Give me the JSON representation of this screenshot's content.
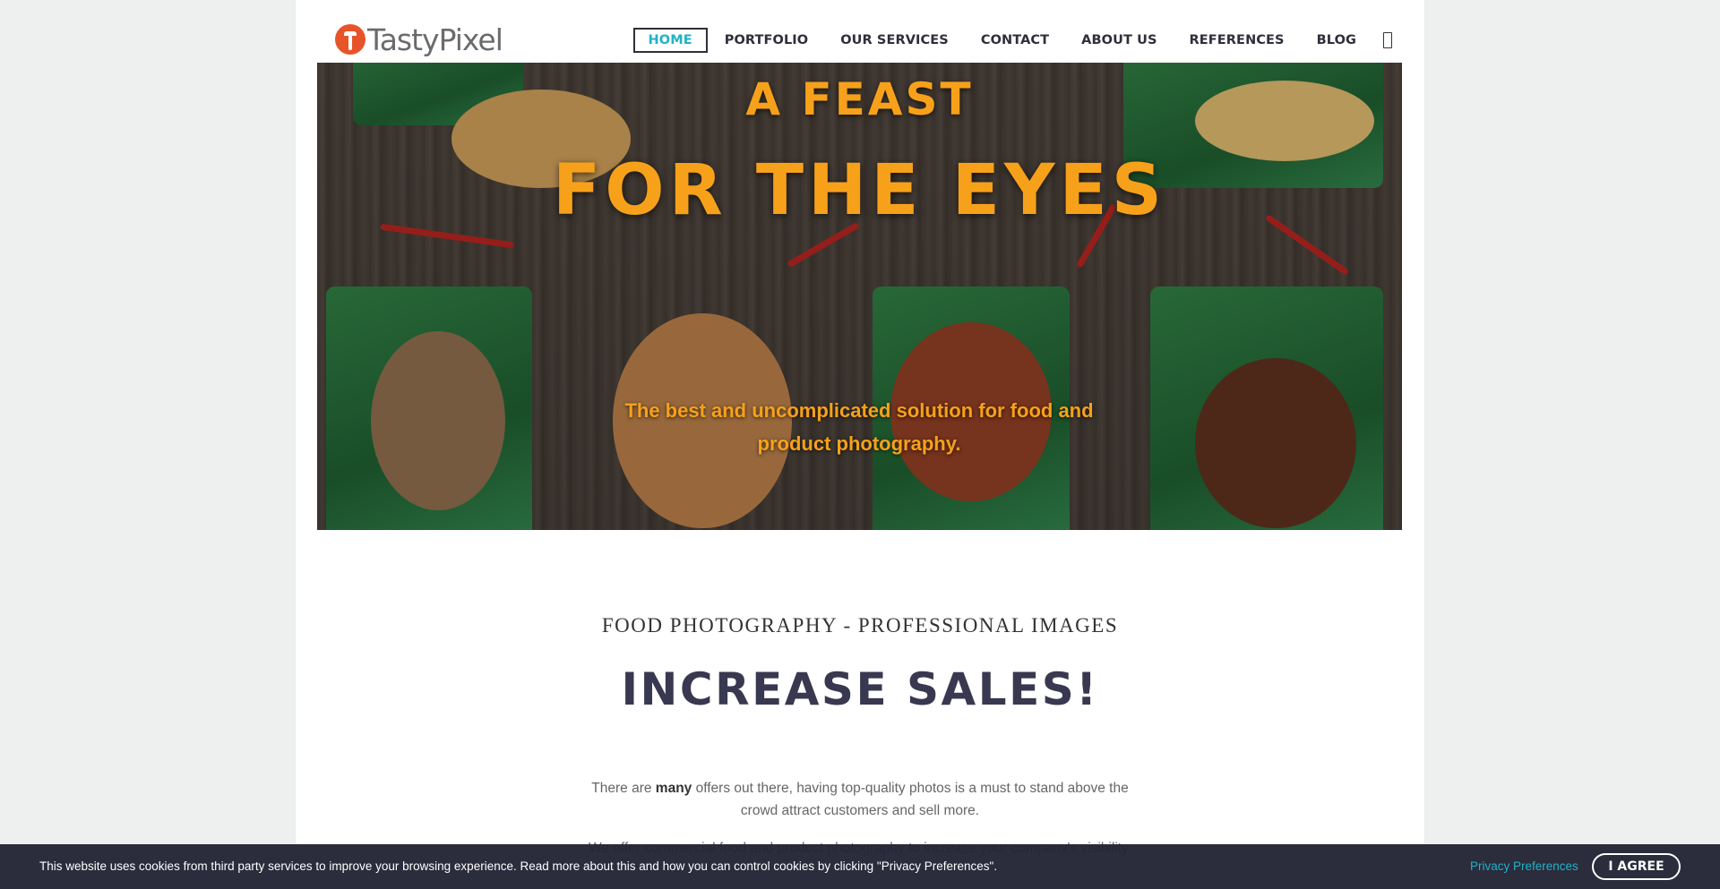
{
  "brand": {
    "name": "TastyPixel"
  },
  "nav": {
    "items": [
      {
        "label": "HOME",
        "active": true
      },
      {
        "label": "PORTFOLIO"
      },
      {
        "label": "OUR SERVICES"
      },
      {
        "label": "CONTACT"
      },
      {
        "label": "ABOUT US"
      },
      {
        "label": "REFERENCES"
      },
      {
        "label": "BLOG"
      }
    ],
    "search_icon": "search-icon"
  },
  "hero": {
    "kicker": "A FEAST",
    "title": "FOR THE EYES",
    "subtitle": "The best and uncomplicated solution for food and product photography."
  },
  "content": {
    "eyebrow": "FOOD PHOTOGRAPHY - PROFESSIONAL IMAGES",
    "headline": "INCREASE SALES!",
    "para1_pre": "There are ",
    "para1_bold": "many",
    "para1_post": " offers out there, having top-quality photos is a must to stand above the crowd attract customers and sell more.",
    "para2": "We offer commercial food and product photography to increase your company's visibility."
  },
  "cookie": {
    "text": "This website uses cookies from third party services to improve your browsing experience. Read more about this and how you can control cookies by clicking \"Privacy Preferences\".",
    "link": "Privacy Preferences",
    "agree": "I AGREE"
  },
  "colors": {
    "accent": "#1fb3c8",
    "hero_text": "#f7a11a",
    "headline": "#383850",
    "cookie_bg": "#222334"
  }
}
